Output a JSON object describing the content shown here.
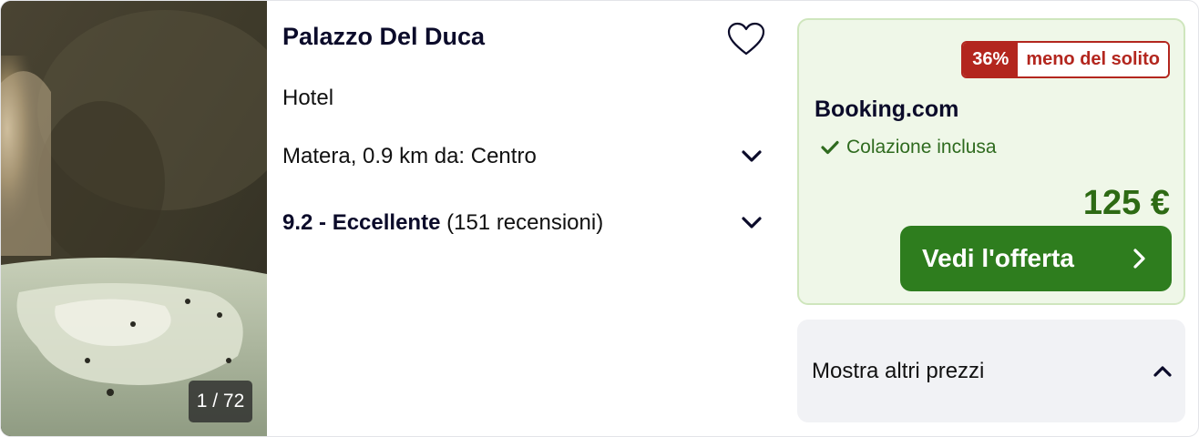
{
  "photo": {
    "counter": "1 / 72"
  },
  "hotel": {
    "name": "Palazzo Del Duca",
    "type": "Hotel",
    "location": "Matera, 0.9 km da: Centro",
    "rating_label": "9.2 - Eccellente",
    "reviews": "(151 recensioni)"
  },
  "deal": {
    "discount_pct": "36%",
    "discount_text": "meno del solito",
    "provider": "Booking.com",
    "amenity": "Colazione inclusa",
    "price": "125 €",
    "cta_label": "Vedi l'offerta"
  },
  "more_prices": {
    "label": "Mostra altri prezzi"
  },
  "colors": {
    "accent_green": "#2e7d1e",
    "deal_bg": "#eff7e8",
    "badge_red": "#b3261e",
    "text_dark": "#0b0b2a"
  },
  "icons": [
    "heart-icon",
    "chevron-down-icon",
    "checkmark-icon",
    "chevron-right-icon",
    "chevron-up-icon"
  ]
}
